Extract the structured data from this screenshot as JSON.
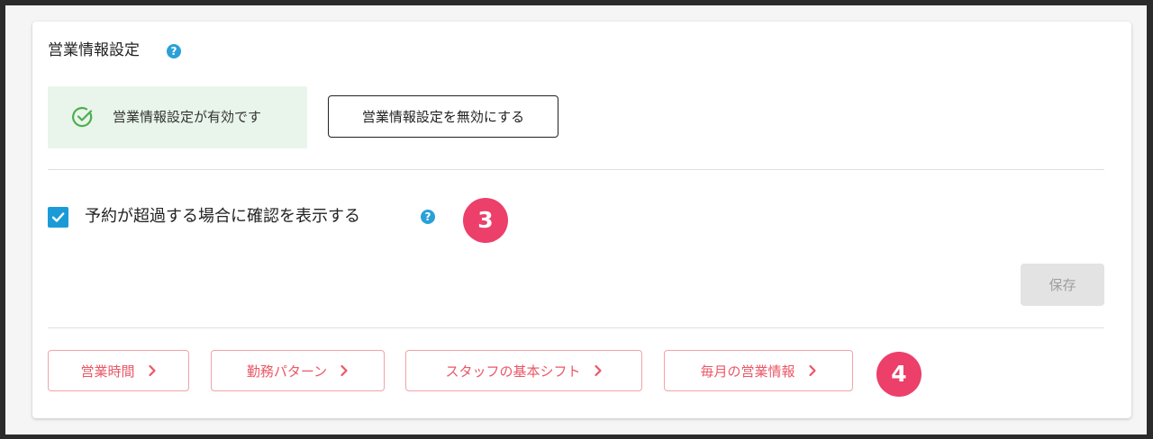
{
  "section": {
    "title": "営業情報設定",
    "title_help_icon": "help-icon"
  },
  "status": {
    "text": "営業情報設定が有効です",
    "icon": "check-circle-icon",
    "color": "#e9f5ea"
  },
  "buttons": {
    "disable": "営業情報設定を無効にする",
    "save": "保存"
  },
  "checkbox": {
    "label": "予約が超過する場合に確認を表示する",
    "checked": true,
    "help_icon": "help-icon"
  },
  "badges": {
    "step3": "3",
    "step4": "4"
  },
  "nav_links": [
    {
      "label": "営業時間"
    },
    {
      "label": "勤務パターン"
    },
    {
      "label": "スタッフの基本シフト"
    },
    {
      "label": "毎月の営業情報"
    }
  ],
  "colors": {
    "accent_blue": "#1a9bd7",
    "badge_pink": "#ec3f6a",
    "nav_text": "#ea5766",
    "nav_border": "#f2a3a8",
    "success_bg": "#e9f5ea",
    "success_icon": "#4caf50"
  }
}
